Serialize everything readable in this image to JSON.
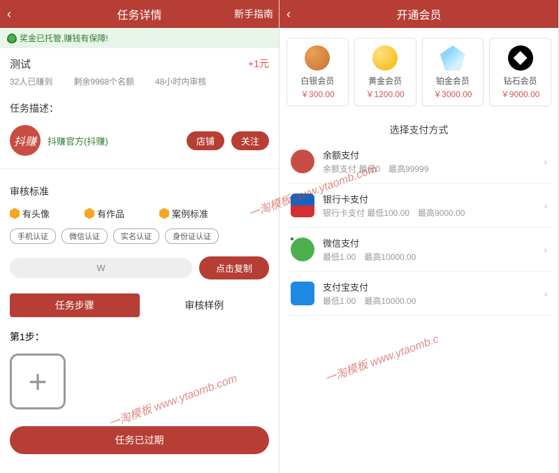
{
  "left": {
    "header": {
      "title": "任务详情",
      "right": "新手指南"
    },
    "notice": "奖金已托管,赚钱有保障!",
    "task": {
      "name": "测试",
      "reward": "+1元"
    },
    "meta": {
      "earned": "32人已赚到",
      "remain": "剩余9968个名额",
      "review": "48小时内审核"
    },
    "desc_label": "任务描述：",
    "shop": {
      "name": "抖赚官方(抖赚)",
      "icon_text": "抖赚",
      "btn_shop": "店铺",
      "btn_follow": "关注"
    },
    "std_label": "审核标准",
    "std_items": [
      "有头像",
      "有作品",
      "案例标准"
    ],
    "tags": [
      "手机认证",
      "微信认证",
      "实名认证",
      "身份证认证"
    ],
    "copy": {
      "value": "W",
      "btn": "点击复制"
    },
    "tabs": {
      "active": "任务步骤",
      "inactive": "审核样例"
    },
    "step": "第1步：",
    "expired_btn": "任务已过期"
  },
  "right": {
    "header": {
      "title": "开通会员"
    },
    "tiers": [
      {
        "name": "白银会员",
        "price": "￥300.00",
        "cls": "ico-silver"
      },
      {
        "name": "黄金会员",
        "price": "￥1200.00",
        "cls": "ico-gold"
      },
      {
        "name": "铂金会员",
        "price": "￥3000.00",
        "cls": "ico-plat"
      },
      {
        "name": "钻石会员",
        "price": "￥9000.00",
        "cls": "ico-diam"
      }
    ],
    "pay_title": "选择支付方式",
    "methods": [
      {
        "name": "余额支付",
        "sub": "余额支付 最低0　最高99999",
        "cls": "pi-bal"
      },
      {
        "name": "银行卡支付",
        "sub": "银行卡支付 最低100.00　最高9000.00",
        "cls": "pi-bank"
      },
      {
        "name": "微信支付",
        "sub": "最低1.00　最高10000.00",
        "cls": "pi-wx"
      },
      {
        "name": "支付宝支付",
        "sub": "最低1.00　最高10000.00",
        "cls": "pi-ali"
      }
    ]
  },
  "watermark": "一淘模板 www.ytaomb.com",
  "watermark_short": "一淘模板 www.ytaomb.c"
}
